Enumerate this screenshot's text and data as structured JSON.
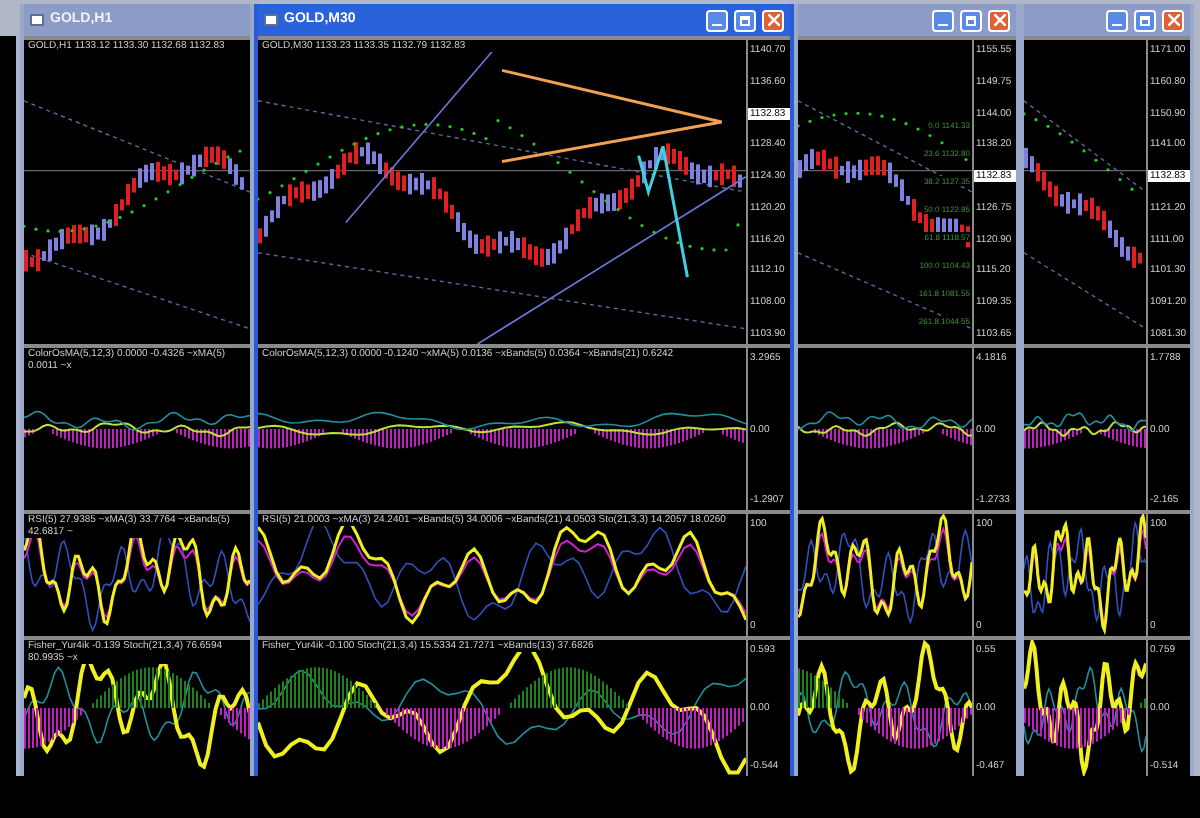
{
  "windows": [
    {
      "kind": "sliver"
    },
    {
      "kind": "framed",
      "title": "GOLD,H1",
      "active": false,
      "buttons_visible": false,
      "panes": [
        {
          "kind": "price",
          "header": "GOLD,H1  1133.12 1133.30 1132.68 1132.83"
        },
        {
          "kind": "osma",
          "header": "ColorOsMA(5,12,3) 0.0000 -0.4326 ~xMA(5) 0.0011 ~x"
        },
        {
          "kind": "rsi",
          "header": "RSI(5) 27.9385 ~xMA(3) 33.7764 ~xBands(5) 42.6817 ~"
        },
        {
          "kind": "fisher",
          "header": "Fisher_Yur4ik -0.139 Stoch(21,3,4) 76.6594 80.9935 ~x"
        }
      ]
    },
    {
      "kind": "framed",
      "title": "GOLD,M30",
      "active": true,
      "buttons_visible": true,
      "panes": [
        {
          "kind": "price",
          "header": "GOLD,M30  1133.23 1133.35 1132.79 1132.83",
          "axis": [
            {
              "text": "1140.70",
              "highlight": false
            },
            {
              "text": "1136.60",
              "highlight": false
            },
            {
              "text": "1132.83",
              "highlight": true
            },
            {
              "text": "1128.40",
              "highlight": false
            },
            {
              "text": "1124.30",
              "highlight": false
            },
            {
              "text": "1120.20",
              "highlight": false
            },
            {
              "text": "1116.20",
              "highlight": false
            },
            {
              "text": "1112.10",
              "highlight": false
            },
            {
              "text": "1108.00",
              "highlight": false
            },
            {
              "text": "1103.90",
              "highlight": false
            }
          ]
        },
        {
          "kind": "osma",
          "header": "ColorOsMA(5,12,3) 0.0000 -0.1240 ~xMA(5) 0.0136 ~xBands(5) 0.0364 ~xBands(21) 0.6242",
          "axis": [
            {
              "text": "3.2965",
              "highlight": false
            },
            {
              "text": "0.00",
              "highlight": false
            },
            {
              "text": "-1.2907",
              "highlight": false
            }
          ]
        },
        {
          "kind": "rsi",
          "header": "RSI(5) 21.0003 ~xMA(3) 24.2401 ~xBands(5) 34.0006 ~xBands(21) 4.0503 Sto(21,3,3) 14.2057 18.0260",
          "axis": [
            {
              "text": "100",
              "highlight": false
            },
            {
              "text": "0",
              "highlight": false
            }
          ]
        },
        {
          "kind": "fisher",
          "header": "Fisher_Yur4ik -0.100 Stoch(21,3,4) 15.5334 21.7271 ~xBands(13) 37.6826",
          "axis": [
            {
              "text": "0.593",
              "highlight": false
            },
            {
              "text": "0.00",
              "highlight": false
            },
            {
              "text": "-0.544",
              "highlight": false
            }
          ]
        }
      ]
    },
    {
      "kind": "framed",
      "active": false,
      "buttons_visible": true,
      "panes": [
        {
          "kind": "price",
          "fib_levels": [
            "0.0 1141.33",
            "23.6 1132.80",
            "38.2 1127.35",
            "50.0 1122.95",
            "61.8 1118.57",
            "100.0 1104.43",
            "161.8 1081.55",
            "261.8 1044.55"
          ],
          "axis": [
            {
              "text": "1155.55",
              "highlight": false
            },
            {
              "text": "1149.75",
              "highlight": false
            },
            {
              "text": "1144.00",
              "highlight": false
            },
            {
              "text": "1138.20",
              "highlight": false
            },
            {
              "text": "1132.83",
              "highlight": true
            },
            {
              "text": "1126.75",
              "highlight": false
            },
            {
              "text": "1120.90",
              "highlight": false
            },
            {
              "text": "1115.20",
              "highlight": false
            },
            {
              "text": "1109.35",
              "highlight": false
            },
            {
              "text": "1103.65",
              "highlight": false
            }
          ]
        },
        {
          "kind": "osma",
          "axis": [
            {
              "text": "4.1816",
              "highlight": false
            },
            {
              "text": "0.00",
              "highlight": false
            },
            {
              "text": "-1.2733",
              "highlight": false
            }
          ]
        },
        {
          "kind": "rsi",
          "axis": [
            {
              "text": "100",
              "highlight": false
            },
            {
              "text": "0",
              "highlight": false
            }
          ]
        },
        {
          "kind": "fisher",
          "axis": [
            {
              "text": "0.55",
              "highlight": false
            },
            {
              "text": "0.00",
              "highlight": false
            },
            {
              "text": "-0.467",
              "highlight": false
            }
          ]
        }
      ]
    },
    {
      "kind": "framed",
      "active": false,
      "buttons_visible": true,
      "panes": [
        {
          "kind": "price",
          "axis": [
            {
              "text": "1171.00",
              "highlight": false
            },
            {
              "text": "1160.80",
              "highlight": false
            },
            {
              "text": "1150.90",
              "highlight": false
            },
            {
              "text": "1141.00",
              "highlight": false
            },
            {
              "text": "1132.83",
              "highlight": true
            },
            {
              "text": "1121.20",
              "highlight": false
            },
            {
              "text": "1111.00",
              "highlight": false
            },
            {
              "text": "1101.30",
              "highlight": false
            },
            {
              "text": "1091.20",
              "highlight": false
            },
            {
              "text": "1081.30",
              "highlight": false
            }
          ]
        },
        {
          "kind": "osma",
          "axis": [
            {
              "text": "1.7788",
              "highlight": false
            },
            {
              "text": "0.00",
              "highlight": false
            },
            {
              "text": "-2.165",
              "highlight": false
            }
          ]
        },
        {
          "kind": "rsi",
          "axis": [
            {
              "text": "100",
              "highlight": false
            },
            {
              "text": "0",
              "highlight": false
            }
          ]
        },
        {
          "kind": "fisher",
          "axis": [
            {
              "text": "0.759",
              "highlight": false
            },
            {
              "text": "0.00",
              "highlight": false
            },
            {
              "text": "-0.514",
              "highlight": false
            }
          ]
        }
      ]
    }
  ]
}
